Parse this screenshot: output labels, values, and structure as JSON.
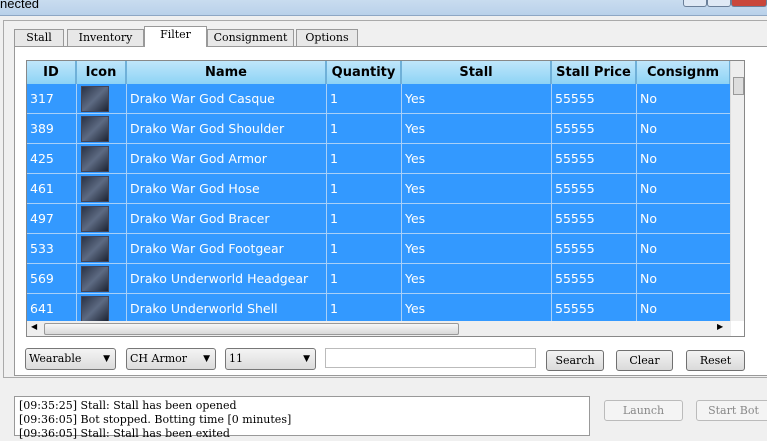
{
  "window": {
    "title": "nected"
  },
  "tabs": [
    {
      "label": "Stall"
    },
    {
      "label": "Inventory"
    },
    {
      "label": "Filter"
    },
    {
      "label": "Consignment"
    },
    {
      "label": "Options"
    }
  ],
  "grid": {
    "columns": [
      "ID",
      "Icon",
      "Name",
      "Quantity",
      "Stall",
      "Stall Price",
      "Consignm"
    ],
    "rows": [
      {
        "id": "317",
        "name": "Drako War God Casque",
        "qty": "1",
        "stall": "Yes",
        "price": "55555",
        "consign": "No"
      },
      {
        "id": "389",
        "name": "Drako War God Shoulder",
        "qty": "1",
        "stall": "Yes",
        "price": "55555",
        "consign": "No"
      },
      {
        "id": "425",
        "name": "Drako War God Armor",
        "qty": "1",
        "stall": "Yes",
        "price": "55555",
        "consign": "No"
      },
      {
        "id": "461",
        "name": "Drako War God Hose",
        "qty": "1",
        "stall": "Yes",
        "price": "55555",
        "consign": "No"
      },
      {
        "id": "497",
        "name": "Drako War God Bracer",
        "qty": "1",
        "stall": "Yes",
        "price": "55555",
        "consign": "No"
      },
      {
        "id": "533",
        "name": "Drako War God Footgear",
        "qty": "1",
        "stall": "Yes",
        "price": "55555",
        "consign": "No"
      },
      {
        "id": "569",
        "name": "Drako Underworld Headgear",
        "qty": "1",
        "stall": "Yes",
        "price": "55555",
        "consign": "No"
      },
      {
        "id": "641",
        "name": "Drako Underworld Shell",
        "qty": "1",
        "stall": "Yes",
        "price": "55555",
        "consign": "No"
      }
    ]
  },
  "filters": {
    "type": "Wearable",
    "category": "CH Armor",
    "degree": "11",
    "search_value": "",
    "search": "Search",
    "clear": "Clear",
    "reset": "Reset"
  },
  "log": [
    "[09:35:25] Stall: Stall has been opened",
    "[09:36:05] Bot stopped. Botting time [0 minutes]",
    "[09:36:05] Stall: Stall has been exited"
  ],
  "buttons": {
    "launch": "Launch",
    "start_bot": "Start Bot"
  }
}
